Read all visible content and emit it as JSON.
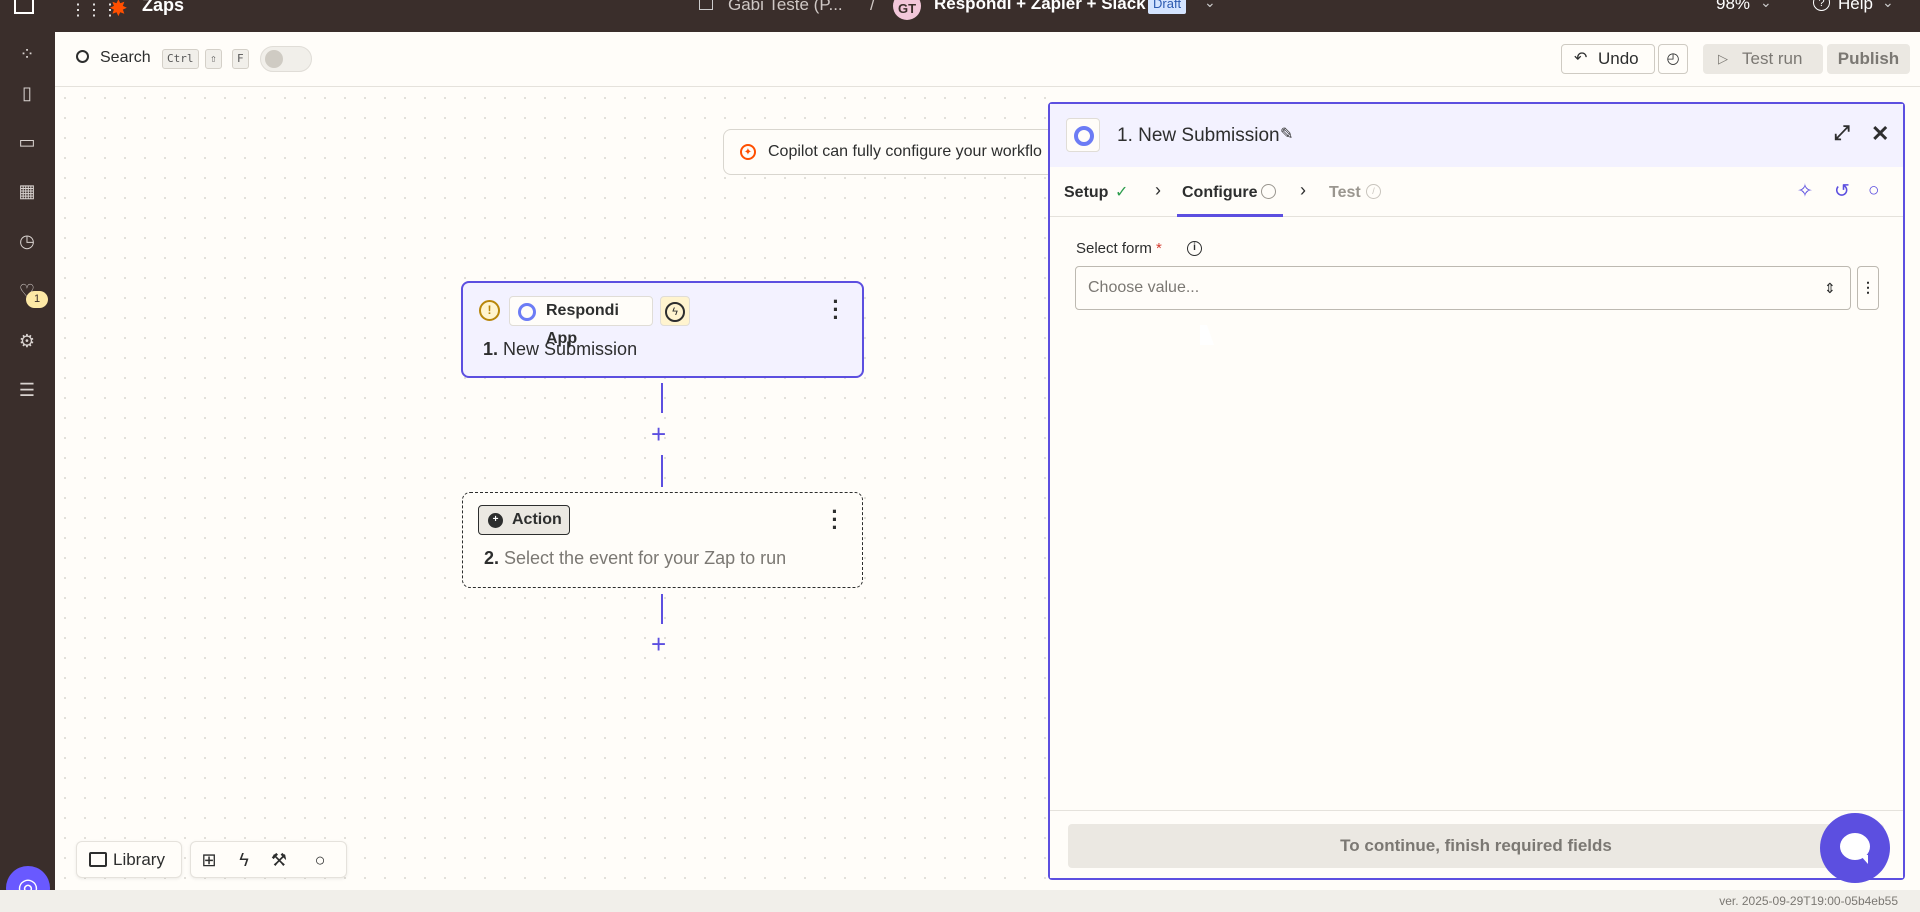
{
  "topbar": {
    "app_name": "Zaps",
    "folder": "Gabi Teste (P...",
    "separator": "/",
    "avatar_initials": "GT",
    "zap_name": "Respondi + Zapier + Slack",
    "status_badge": "Draft",
    "zoom": "98%",
    "help": "Help"
  },
  "rail": {
    "notification_count": "1",
    "icons": [
      "apps-icon",
      "zap-icon",
      "interfaces-icon",
      "tables-icon",
      "history-icon",
      "monitoring-icon",
      "settings-icon",
      "archive-icon"
    ]
  },
  "toolbar": {
    "search_label": "Search",
    "shortcut_keys": [
      "Ctrl",
      "⇧",
      "F"
    ],
    "undo_label": "Undo",
    "test_run_label": "Test run",
    "publish_label": "Publish"
  },
  "canvas": {
    "copilot_banner": "Copilot can fully configure your workflo",
    "trigger": {
      "app_name": "Respondi App",
      "number": "1.",
      "title": "New Submission"
    },
    "action": {
      "chip_label": "Action",
      "number": "2.",
      "title": "Select the event for your Zap to run"
    },
    "plus_label": "+"
  },
  "bottom_tools": {
    "library_label": "Library"
  },
  "panel": {
    "title": "1. New Submission",
    "tabs": {
      "setup": "Setup",
      "configure": "Configure",
      "test": "Test"
    },
    "field_label": "Select form",
    "required_mark": "*",
    "select_placeholder": "Choose value...",
    "continue_label": "To continue, finish required fields"
  },
  "footer": {
    "version": "ver. 2025-09-29T19:00-05b4eb55"
  },
  "colors": {
    "accent": "#5c4fe0",
    "brand_orange": "#ff4f00",
    "chrome": "#3a2e2b",
    "success": "#2e9e4f"
  }
}
